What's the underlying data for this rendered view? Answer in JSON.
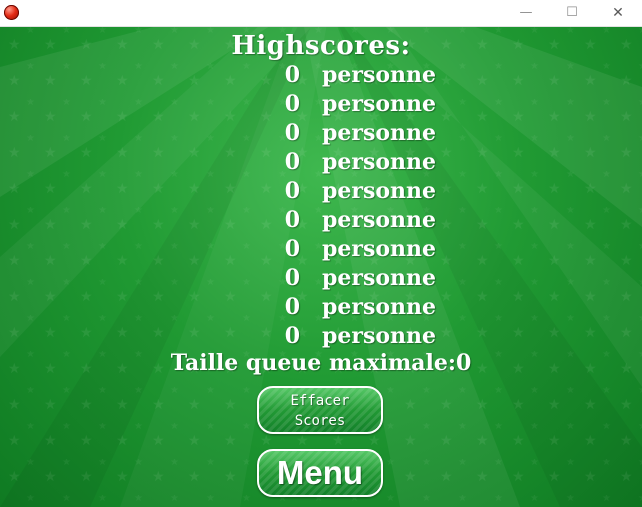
{
  "window": {
    "controls": {
      "minimize": "—",
      "maximize": "☐",
      "close": "✕"
    }
  },
  "highscores": {
    "title": "Highscores:",
    "entries": [
      {
        "score": "0",
        "name": "personne"
      },
      {
        "score": "0",
        "name": "personne"
      },
      {
        "score": "0",
        "name": "personne"
      },
      {
        "score": "0",
        "name": "personne"
      },
      {
        "score": "0",
        "name": "personne"
      },
      {
        "score": "0",
        "name": "personne"
      },
      {
        "score": "0",
        "name": "personne"
      },
      {
        "score": "0",
        "name": "personne"
      },
      {
        "score": "0",
        "name": "personne"
      },
      {
        "score": "0",
        "name": "personne"
      }
    ],
    "max_tail": "Taille queue maximale:0"
  },
  "buttons": {
    "clear_line1": "Effacer",
    "clear_line2": "Scores",
    "menu": "Menu"
  },
  "colors": {
    "background": "#209a33",
    "text": "#ffffff",
    "button_border": "#ffffff",
    "app_icon": "#e32a14"
  },
  "icons": {
    "app": "red-ball-icon",
    "minimize": "minimize-icon",
    "maximize": "maximize-icon",
    "close": "close-icon"
  }
}
